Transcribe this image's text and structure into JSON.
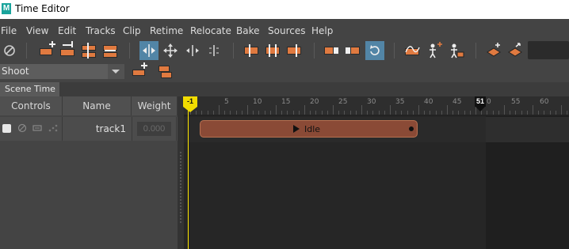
{
  "window": {
    "title": "Time Editor",
    "app_icon": "maya-app-icon"
  },
  "menu": [
    "File",
    "View",
    "Edit",
    "Tracks",
    "Clip",
    "Retime",
    "Relocate",
    "Bake",
    "Sources",
    "Help"
  ],
  "toolbar": {
    "buttons": [
      "mute-icon",
      "add-track-icon",
      "add-clip-icon",
      "split-clip-icon",
      "merge-clip-icon",
      "slide-tool-icon",
      "move-tool-icon",
      "snap-frames-icon",
      "snap-clips-icon",
      "trim-start-icon",
      "trim-both-icon",
      "trim-end-icon",
      "crossfade-out-icon",
      "crossfade-in-icon",
      "loop-icon",
      "graph-editor-icon",
      "add-character-icon",
      "add-attribute-icon",
      "key-add-icon",
      "key-move-icon"
    ],
    "active_button": "loop-icon",
    "accent_color": "#5285a6",
    "clip_icon_color": "#e07a40"
  },
  "composition": {
    "selected": "Shoot"
  },
  "tabs": [
    "Scene Time"
  ],
  "columns": {
    "controls": "Controls",
    "name": "Name",
    "weight": "Weight"
  },
  "tracks": [
    {
      "name": "track1",
      "weight": "0.000"
    }
  ],
  "ruler": {
    "labels": [
      "5",
      "10",
      "15",
      "20",
      "25",
      "30",
      "35",
      "40",
      "45",
      "0",
      "55",
      "60"
    ],
    "current_frame": "-1",
    "end_frame": "51"
  },
  "clip": {
    "label": "Idle",
    "color": "#8a4a36"
  },
  "playhead_color": "#f2dc00"
}
